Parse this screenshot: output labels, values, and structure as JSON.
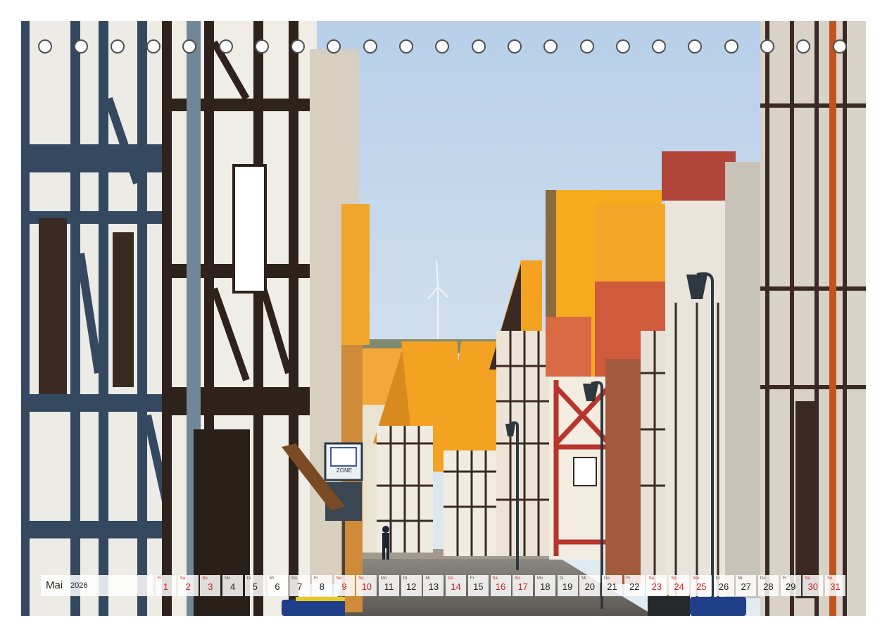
{
  "calendar": {
    "month": "Mai",
    "year": "2026",
    "days": [
      {
        "wd": "Fr",
        "n": "1",
        "red": true
      },
      {
        "wd": "Sa",
        "n": "2",
        "red": true
      },
      {
        "wd": "So",
        "n": "3",
        "red": true
      },
      {
        "wd": "Mo",
        "n": "4",
        "red": false
      },
      {
        "wd": "Di",
        "n": "5",
        "red": false
      },
      {
        "wd": "Mi",
        "n": "6",
        "red": false
      },
      {
        "wd": "Do",
        "n": "7",
        "red": false
      },
      {
        "wd": "Fr",
        "n": "8",
        "red": false
      },
      {
        "wd": "Sa",
        "n": "9",
        "red": true
      },
      {
        "wd": "So",
        "n": "10",
        "red": true
      },
      {
        "wd": "Mo",
        "n": "11",
        "red": false
      },
      {
        "wd": "Di",
        "n": "12",
        "red": false
      },
      {
        "wd": "Mi",
        "n": "13",
        "red": false
      },
      {
        "wd": "Do",
        "n": "14",
        "red": true
      },
      {
        "wd": "Fr",
        "n": "15",
        "red": false
      },
      {
        "wd": "Sa",
        "n": "16",
        "red": true
      },
      {
        "wd": "So",
        "n": "17",
        "red": true
      },
      {
        "wd": "Mo",
        "n": "18",
        "red": false
      },
      {
        "wd": "Di",
        "n": "19",
        "red": false
      },
      {
        "wd": "Mi",
        "n": "20",
        "red": false
      },
      {
        "wd": "Do",
        "n": "21",
        "red": false
      },
      {
        "wd": "Fr",
        "n": "22",
        "red": false
      },
      {
        "wd": "Sa",
        "n": "23",
        "red": true
      },
      {
        "wd": "So",
        "n": "24",
        "red": true
      },
      {
        "wd": "Mo",
        "n": "25",
        "red": true
      },
      {
        "wd": "Di",
        "n": "26",
        "red": false
      },
      {
        "wd": "Mi",
        "n": "27",
        "red": false
      },
      {
        "wd": "Do",
        "n": "28",
        "red": false
      },
      {
        "wd": "Fr",
        "n": "29",
        "red": false
      },
      {
        "wd": "Sa",
        "n": "30",
        "red": true
      },
      {
        "wd": "So",
        "n": "31",
        "red": true
      }
    ]
  },
  "photo": {
    "sign_text": "ZONE"
  },
  "colors": {
    "sky": "#c9dbef",
    "roof_orange": "#f0a020",
    "timber": "#3a2a22",
    "red_frame": "#b8342c",
    "holiday_red": "#d11f1f"
  }
}
